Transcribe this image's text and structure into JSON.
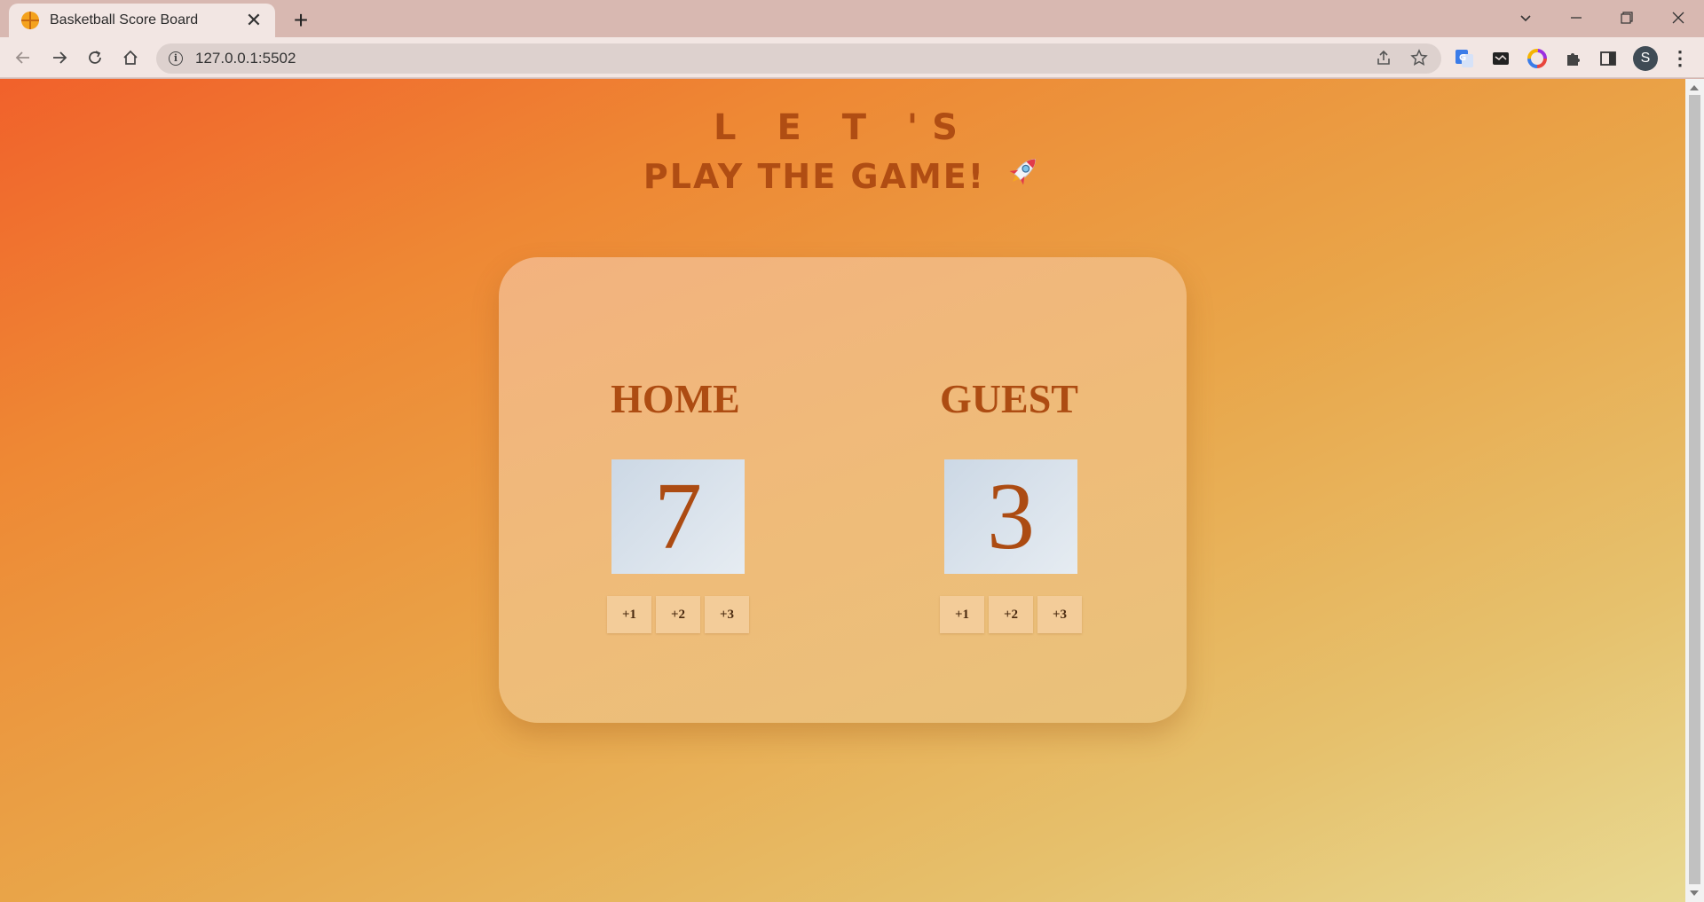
{
  "browser": {
    "tab_title": "Basketball Score Board",
    "new_tab_symbol": "+",
    "tab_close_symbol": "✕",
    "url": "127.0.0.1:5502",
    "profile_initial": "S"
  },
  "page": {
    "heading_line1": "L E T 'S",
    "heading_line2": "PLAY THE GAME!",
    "rocket_icon": "rocket-icon",
    "colors": {
      "accent_text": "#ac4b12",
      "gradient_start": "#f1612b",
      "gradient_end": "#e8d992"
    }
  },
  "scoreboard": {
    "home": {
      "name": "HOME",
      "score": "7",
      "buttons": [
        "+1",
        "+2",
        "+3"
      ]
    },
    "guest": {
      "name": "GUEST",
      "score": "3",
      "buttons": [
        "+1",
        "+2",
        "+3"
      ]
    }
  }
}
